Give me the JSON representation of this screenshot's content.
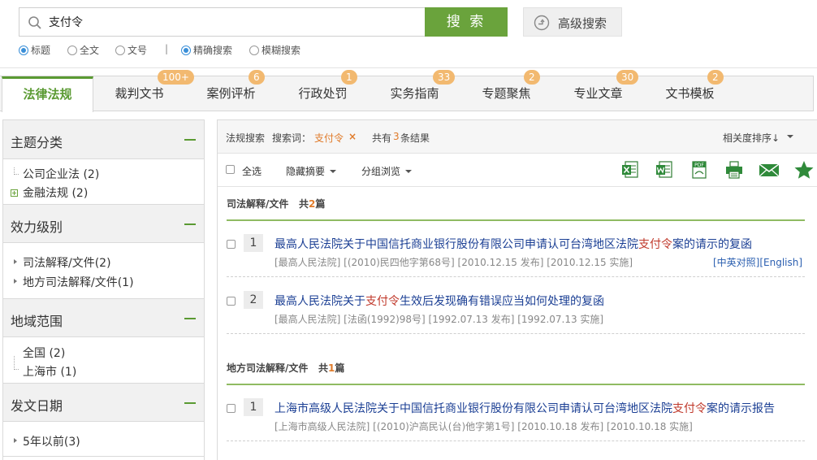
{
  "search": {
    "value": "支付令",
    "button": "搜 索",
    "advanced": "高级搜索",
    "options": {
      "title": "标题",
      "fulltext": "全文",
      "docnum": "文号",
      "separator": "|",
      "exact": "精确搜索",
      "fuzzy": "模糊搜索"
    }
  },
  "tabs": [
    {
      "label": "法律法规",
      "badge": ""
    },
    {
      "label": "裁判文书",
      "badge": "100+"
    },
    {
      "label": "案例评析",
      "badge": "6"
    },
    {
      "label": "行政处罚",
      "badge": "1"
    },
    {
      "label": "实务指南",
      "badge": "33"
    },
    {
      "label": "专题聚焦",
      "badge": "2"
    },
    {
      "label": "专业文章",
      "badge": "30"
    },
    {
      "label": "文书模板",
      "badge": "2"
    }
  ],
  "sidebar": {
    "topics": {
      "title": "主题分类",
      "items": [
        "公司企业法 (2)",
        "金融法规 (2)"
      ]
    },
    "level": {
      "title": "效力级别",
      "items": [
        "司法解释/文件(2)",
        "地方司法解释/文件(1)"
      ]
    },
    "region": {
      "title": "地域范围",
      "items": [
        "全国 (2)",
        "上海市 (1)"
      ]
    },
    "date": {
      "title": "发文日期",
      "items": [
        "5年以前(3)"
      ]
    }
  },
  "results_bar": {
    "search_label": "法规搜索",
    "keyword_label": "搜索词：",
    "keyword": "支付令",
    "remove": "×",
    "total_prefix": "共有",
    "total": "3",
    "total_suffix": "条结果",
    "sort": "相关度排序↓"
  },
  "toolbar": {
    "select_all": "全选",
    "hide_summary": "隐藏摘要",
    "group_browse": "分组浏览"
  },
  "sections": [
    {
      "title": "司法解释/文件",
      "count_prefix": "共",
      "count": "2",
      "count_suffix": "篇",
      "results": [
        {
          "num": "1",
          "title_before": "最高人民法院关于中国信托商业银行股份有限公司申请认可台湾地区法院",
          "title_hl": "支付令",
          "title_after": "案的请示的复函",
          "meta": "[最高人民法院] [(2010)民四他字第68号] [2010.12.15 发布] [2010.12.15 实施]",
          "link": "[中英对照][English]"
        },
        {
          "num": "2",
          "title_before": "最高人民法院关于",
          "title_hl": "支付令",
          "title_after": "生效后发现确有错误应当如何处理的复函",
          "meta": "[最高人民法院] [法函(1992)98号] [1992.07.13 发布] [1992.07.13 实施]",
          "link": ""
        }
      ]
    },
    {
      "title": "地方司法解释/文件",
      "count_prefix": "共",
      "count": "1",
      "count_suffix": "篇",
      "results": [
        {
          "num": "1",
          "title_before": "上海市高级人民法院关于中国信托商业银行股份有限公司申请认可台湾地区法院",
          "title_hl": "支付令",
          "title_after": "案的请示报告",
          "meta": "[上海市高级人民法院] [(2010)沪高民认(台)他字第1号] [2010.10.18 发布] [2010.10.18 实施]",
          "link": ""
        }
      ]
    }
  ],
  "icons": [
    "excel-icon",
    "word-icon",
    "pdf-icon",
    "print-icon",
    "email-icon",
    "favorite-star-icon"
  ],
  "colors": {
    "brand_green": "#6aa33c",
    "highlight_orange": "#e07b2a",
    "link_blue": "#1b3f94",
    "badge": "#f2b970"
  }
}
